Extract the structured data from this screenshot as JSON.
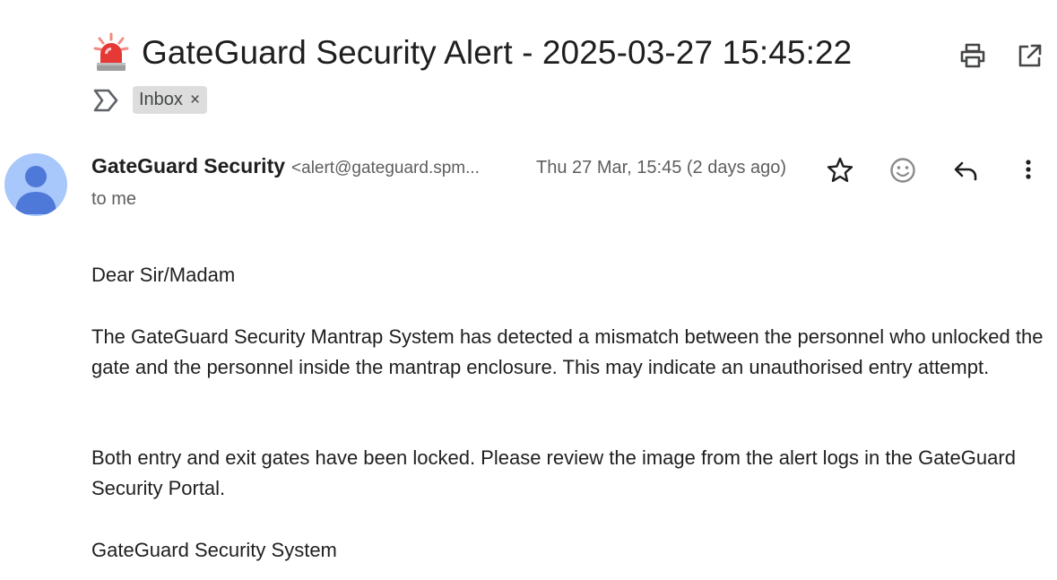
{
  "header": {
    "subject": "GateGuard Security Alert - 2025-03-27 15:45:22",
    "subject_icon": "police-car-light-icon",
    "label_chip": "Inbox",
    "label_chip_close": "×",
    "toolbar_icons": [
      "print-icon",
      "open-in-new-icon"
    ]
  },
  "sender": {
    "name": "GateGuard Security",
    "email": "<alert@gateguard.spm...",
    "date": "Thu 27 Mar, 15:45 (2 days ago)",
    "to": "to me",
    "avatar_color": "#a8c7fa",
    "avatar_figure_color": "#4e79d9",
    "action_icons": [
      "star-icon",
      "emoji-icon",
      "reply-icon",
      "more-vert-icon"
    ]
  },
  "body": {
    "greeting": "Dear Sir/Madam",
    "paragraph1": "The GateGuard Security Mantrap System has detected a mismatch between the personnel who unlocked the gate and the personnel inside the mantrap enclosure. This may indicate an unauthorised entry attempt.",
    "paragraph2": "Both entry and exit gates have been locked. Please review the image from the alert logs in the GateGuard Security Portal.",
    "signature": "GateGuard Security System"
  }
}
